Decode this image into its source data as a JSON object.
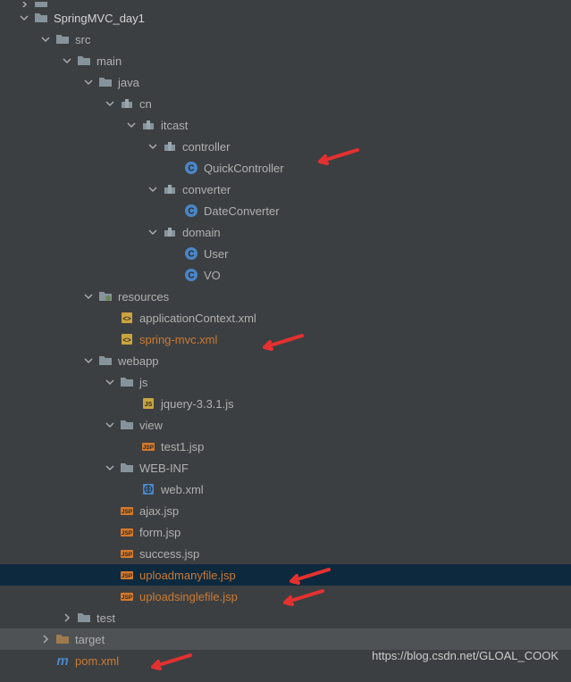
{
  "tree": {
    "project": "SpringMVC_day1",
    "src": "src",
    "main": "main",
    "java": "java",
    "cn": "cn",
    "itcast": "itcast",
    "controller": "controller",
    "quickcontroller": "QuickController",
    "converter": "converter",
    "dateconverter": "DateConverter",
    "domain": "domain",
    "user": "User",
    "vo": "VO",
    "resources": "resources",
    "applicationcontext": "applicationContext.xml",
    "springmvc": "spring-mvc.xml",
    "webapp": "webapp",
    "js": "js",
    "jquery": "jquery-3.3.1.js",
    "view": "view",
    "test1jsp": "test1.jsp",
    "webinf": "WEB-INF",
    "webxml": "web.xml",
    "ajaxjsp": "ajax.jsp",
    "formjsp": "form.jsp",
    "successjsp": "success.jsp",
    "uploadmany": "uploadmanyfile.jsp",
    "uploadsingle": "uploadsinglefile.jsp",
    "test": "test",
    "target": "target",
    "pomxml": "pom.xml"
  },
  "watermark": "https://blog.csdn.net/GLOAL_COOK"
}
